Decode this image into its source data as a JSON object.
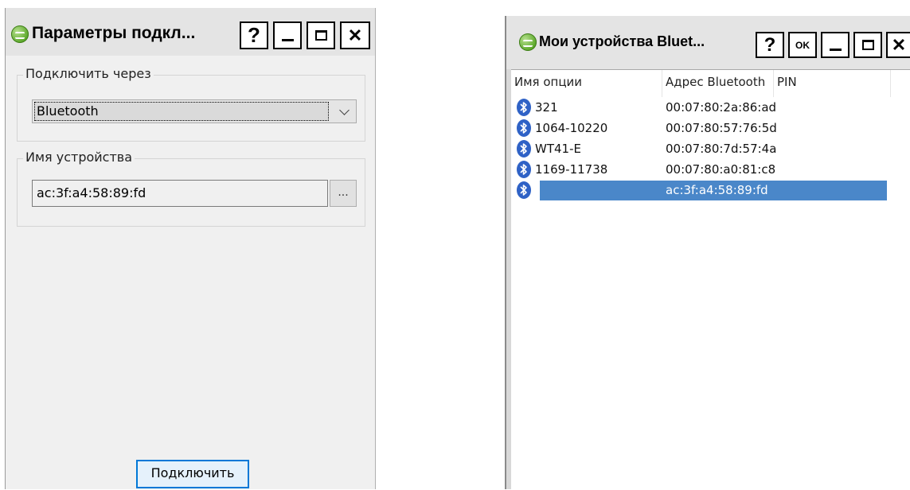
{
  "connection_window": {
    "title": "Параметры подкл...",
    "help_label": "?",
    "close_label": "✕",
    "connect_via": {
      "label": "Подключить через",
      "selected": "Bluetooth"
    },
    "device_name": {
      "label": "Имя устройства",
      "value": "ac:3f:a4:58:89:fd",
      "browse_label": "..."
    },
    "connect_button": "Подключить"
  },
  "devices_window": {
    "title": "Мои устройства Bluet...",
    "help_label": "?",
    "ok_label": "OK",
    "close_label": "✕",
    "columns": [
      "Имя опции",
      "Адрес Bluetooth",
      "PIN"
    ],
    "rows": [
      {
        "name": "321",
        "address": "00:07:80:2a:86:ad",
        "pin": ""
      },
      {
        "name": "1064-10220",
        "address": "00:07:80:57:76:5d",
        "pin": ""
      },
      {
        "name": "WT41-E",
        "address": "00:07:80:7d:57:4a",
        "pin": ""
      },
      {
        "name": "1169-11738",
        "address": "00:07:80:a0:81:c8",
        "pin": ""
      },
      {
        "name": "",
        "address": "ac:3f:a4:58:89:fd",
        "pin": "",
        "selected": true
      }
    ]
  },
  "colors": {
    "selection": "#4a87c9",
    "bluetooth_icon": "#2f62c6",
    "focus_border": "#0078d7"
  }
}
